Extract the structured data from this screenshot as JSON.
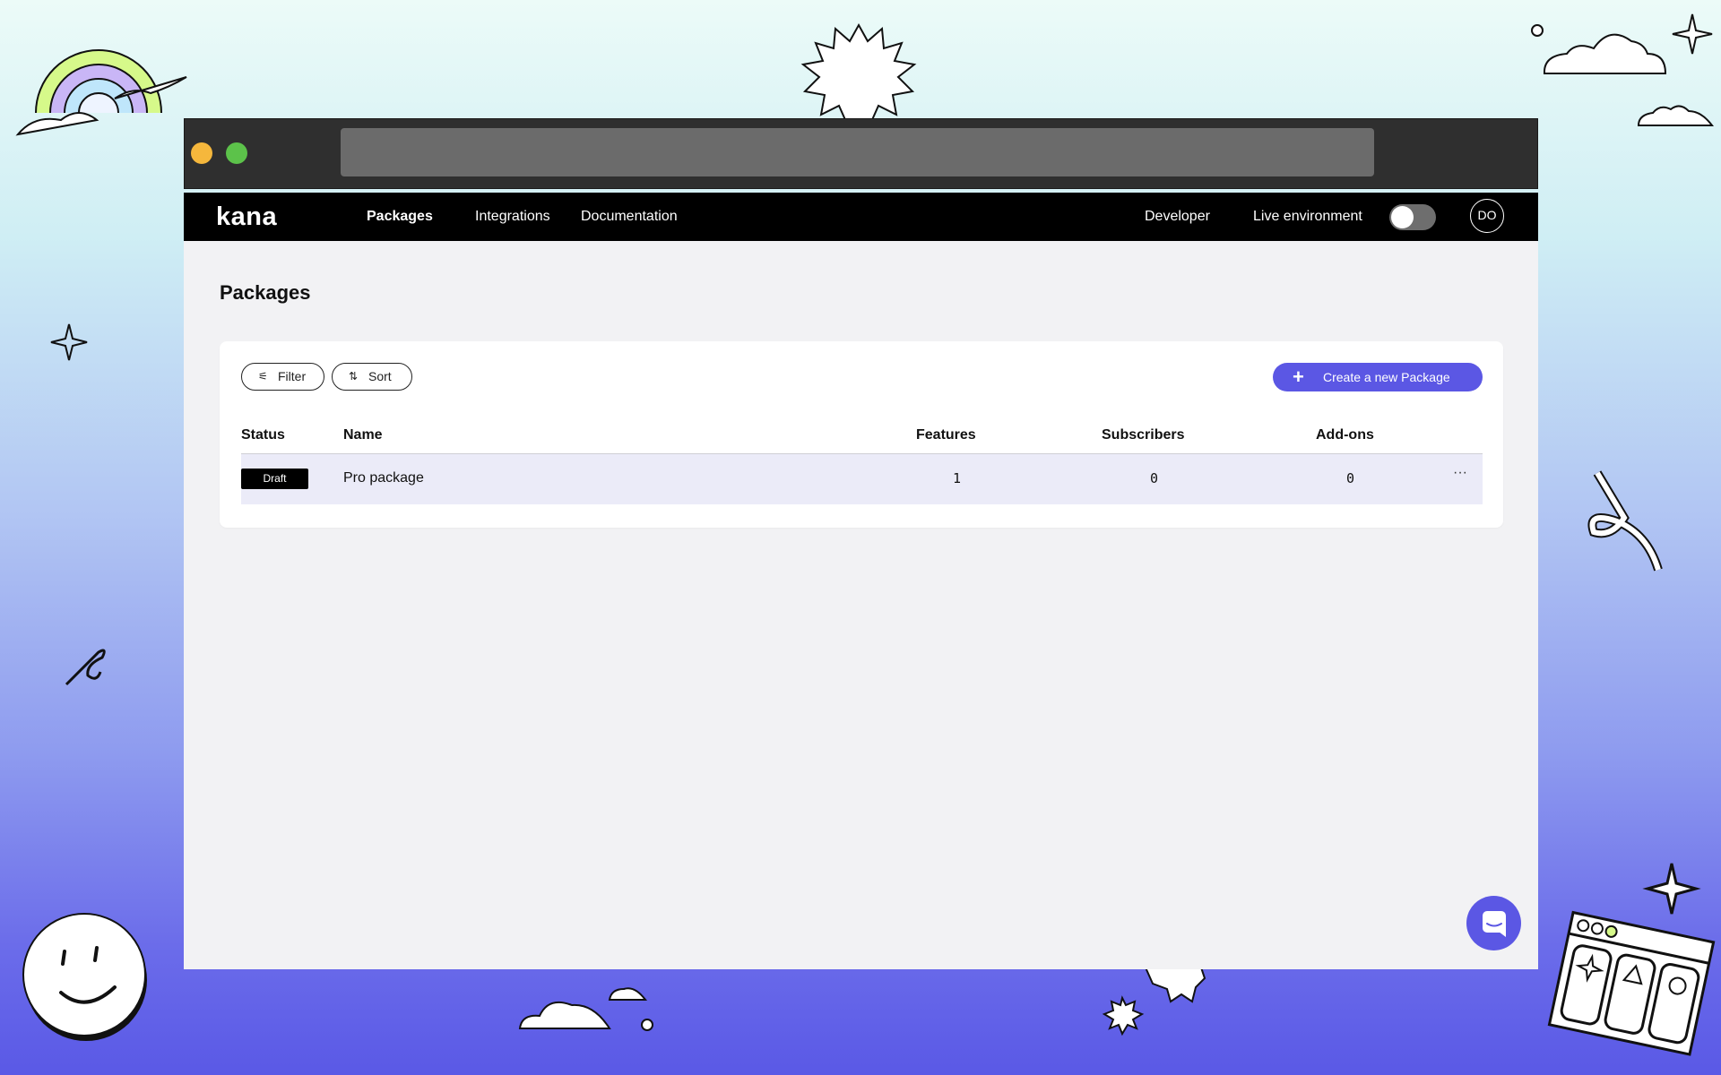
{
  "nav": {
    "logo": "kana",
    "links": [
      "Packages",
      "Integrations",
      "Documentation"
    ],
    "developer": "Developer",
    "live_env": "Live environment",
    "avatar": "DO"
  },
  "page": {
    "title": "Packages"
  },
  "toolbar": {
    "filter": "Filter",
    "sort": "Sort",
    "create": "Create a new Package"
  },
  "table": {
    "headers": [
      "Status",
      "Name",
      "Features",
      "Subscribers",
      "Add-ons"
    ],
    "rows": [
      {
        "status": "Draft",
        "name": "Pro package",
        "features": "1",
        "subscribers": "0",
        "addons": "0",
        "more": "···"
      }
    ]
  },
  "colors": {
    "accent": "#5b57e4",
    "nav_bg": "#000000"
  },
  "icons": [
    "filter-icon",
    "sort-icon",
    "plus-icon",
    "more-icon",
    "chat-icon"
  ]
}
